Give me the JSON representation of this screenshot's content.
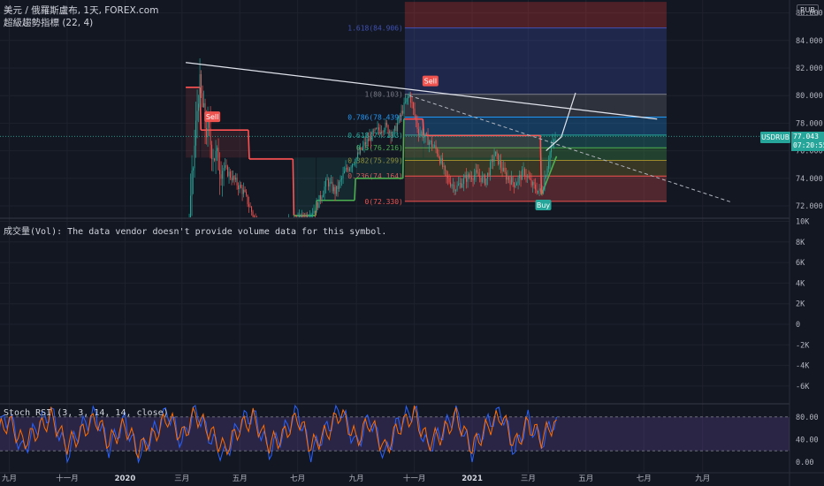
{
  "header": {
    "symbol_line": "美元 / 俄羅斯盧布, 1天, FOREX.com",
    "indicator_line": "超級趨勢指標 (22, 4)"
  },
  "currency_badge": "RUB",
  "last_price": {
    "symbol": "USDRUB",
    "value": "77.043",
    "countdown": "07:20:55",
    "color": "#26a69a"
  },
  "volume_pane": {
    "note": "成交量(Vol): The data vendor doesn't provide volume data for this symbol."
  },
  "rsi_pane": {
    "label": "Stoch RSI (3, 3, 14, 14, close)"
  },
  "signals": [
    {
      "label": "Sell",
      "color": "#ef5350"
    },
    {
      "label": "Sell",
      "color": "#ef5350"
    },
    {
      "label": "Buy",
      "color": "#26a69a"
    }
  ],
  "colors": {
    "background": "#131722",
    "up": "#26a69a",
    "down": "#ef5350",
    "supertrend_up": "#4caf50",
    "supertrend_down": "#ff5252"
  },
  "chart_data": [
    {
      "type": "line",
      "pane": "price",
      "name": "USDRUB",
      "x_tick_labels": [
        "九月",
        "十一月",
        "2020",
        "三月",
        "五月",
        "七月",
        "九月",
        "十一月",
        "2021",
        "三月",
        "五月",
        "七月",
        "九月"
      ],
      "y_tick_labels": [
        "72.000",
        "74.000",
        "76.000",
        "78.000",
        "80.000",
        "82.000",
        "84.000",
        "86.000"
      ],
      "ylim": [
        71.4,
        86.8
      ],
      "x": [
        "2019-12-20",
        "2020-01-20",
        "2020-02-20",
        "2020-03-01",
        "2020-03-10",
        "2020-03-19",
        "2020-03-25",
        "2020-04-05",
        "2020-04-20",
        "2020-05-05",
        "2020-05-20",
        "2020-06-05",
        "2020-06-20",
        "2020-07-05",
        "2020-07-20",
        "2020-08-01",
        "2020-08-10",
        "2020-08-20",
        "2020-09-01",
        "2020-09-10",
        "2020-09-20",
        "2020-10-01",
        "2020-10-10",
        "2020-10-20",
        "2020-10-27",
        "2020-11-05",
        "2020-11-15",
        "2020-11-25",
        "2020-12-05",
        "2020-12-15",
        "2020-12-25",
        "2021-01-05",
        "2021-01-15",
        "2021-01-25",
        "2021-02-05",
        "2021-02-15",
        "2021-02-25",
        "2021-03-05",
        "2021-03-15",
        "2021-03-20",
        "2021-03-25",
        "2021-03-31"
      ],
      "y": [
        63.0,
        61.5,
        63.8,
        66.5,
        72.0,
        80.9,
        78.0,
        75.5,
        74.3,
        73.0,
        70.5,
        69.2,
        70.8,
        71.0,
        71.8,
        73.8,
        73.0,
        74.5,
        75.5,
        76.5,
        77.3,
        77.8,
        77.2,
        79.0,
        80.1,
        77.5,
        76.8,
        76.0,
        74.0,
        73.3,
        74.0,
        74.3,
        73.8,
        75.8,
        74.2,
        73.6,
        74.5,
        73.5,
        72.9,
        74.5,
        76.2,
        77.04
      ],
      "fibonacci": [
        {
          "ratio": "0",
          "price": 72.33,
          "label": "0(72.330)"
        },
        {
          "ratio": "0.236",
          "price": 74.164,
          "label": "0.236(74.164)"
        },
        {
          "ratio": "0.382",
          "price": 75.299,
          "label": "0.382(75.299)"
        },
        {
          "ratio": "0.5",
          "price": 76.216,
          "label": "0.5(76.216)"
        },
        {
          "ratio": "0.618",
          "price": 77.133,
          "label": "0.618(77.133)"
        },
        {
          "ratio": "0.786",
          "price": 78.439,
          "label": "0.786(78.439)"
        },
        {
          "ratio": "1",
          "price": 80.103,
          "label": "1(80.103)"
        },
        {
          "ratio": "1.618",
          "price": 84.906,
          "label": "1.618(84.906)"
        }
      ],
      "fib_zone_colors": [
        "#ef5350",
        "#9c8a2c",
        "#4caf50",
        "#26a69a",
        "#2196f3",
        "#787b86",
        "#3f51b5",
        "#e53935"
      ],
      "supertrend": {
        "x": [
          "2020-03-05",
          "2020-03-20",
          "2020-03-21",
          "2020-05-10",
          "2020-05-11",
          "2020-06-26",
          "2020-06-27",
          "2020-07-20",
          "2020-07-21",
          "2020-08-30",
          "2020-08-31",
          "2020-10-20",
          "2020-10-21",
          "2020-11-10",
          "2020-11-11",
          "2021-03-14",
          "2021-03-15",
          "2021-03-31"
        ],
        "y": [
          80.6,
          80.6,
          77.5,
          77.5,
          75.4,
          75.4,
          71.3,
          71.3,
          72.4,
          72.4,
          74.0,
          74.0,
          78.3,
          78.3,
          77.1,
          77.1,
          72.8,
          75.6
        ]
      },
      "trendline": {
        "x": [
          "2020-03-05",
          "2021-07-15"
        ],
        "y": [
          82.4,
          78.3
        ]
      }
    },
    {
      "type": "line",
      "pane": "volume",
      "y_tick_labels": [
        "10K",
        "8K",
        "6K",
        "4K",
        "2K",
        "0",
        "-2K",
        "-4K",
        "-6K"
      ],
      "ylim": [
        -7000,
        10000
      ]
    },
    {
      "type": "line",
      "pane": "stoch_rsi",
      "y_tick_labels": [
        "80.00",
        "40.00",
        "0.00"
      ],
      "ylim": [
        -2,
        100
      ],
      "bands": [
        20,
        80
      ],
      "x": [
        "2019-08-15",
        "2019-09-01",
        "2019-09-15",
        "2019-10-01",
        "2019-10-15",
        "2019-11-01",
        "2019-11-15",
        "2019-12-01",
        "2019-12-15",
        "2020-01-01",
        "2020-01-15",
        "2020-02-01",
        "2020-02-15",
        "2020-03-01",
        "2020-03-15",
        "2020-04-01",
        "2020-04-15",
        "2020-05-01",
        "2020-05-15",
        "2020-06-01",
        "2020-06-15",
        "2020-07-01",
        "2020-07-15",
        "2020-08-01",
        "2020-08-15",
        "2020-09-01",
        "2020-09-15",
        "2020-10-01",
        "2020-10-15",
        "2020-11-01",
        "2020-11-15",
        "2020-12-01",
        "2020-12-15",
        "2021-01-01",
        "2021-01-15",
        "2021-02-01",
        "2021-02-15",
        "2021-03-01",
        "2021-03-15",
        "2021-03-31"
      ],
      "series": [
        {
          "name": "K",
          "values": [
            55,
            80,
            20,
            65,
            90,
            15,
            60,
            85,
            25,
            75,
            10,
            55,
            90,
            35,
            95,
            40,
            10,
            70,
            85,
            20,
            50,
            90,
            15,
            60,
            95,
            30,
            80,
            10,
            70,
            92,
            25,
            55,
            88,
            15,
            65,
            90,
            20,
            75,
            35,
            80
          ]
        },
        {
          "name": "D",
          "values": [
            50,
            70,
            35,
            55,
            80,
            30,
            50,
            78,
            35,
            65,
            22,
            48,
            80,
            45,
            85,
            50,
            22,
            60,
            78,
            32,
            45,
            80,
            28,
            52,
            88,
            40,
            72,
            22,
            60,
            85,
            35,
            50,
            80,
            25,
            58,
            82,
            30,
            68,
            42,
            75
          ]
        }
      ]
    }
  ]
}
